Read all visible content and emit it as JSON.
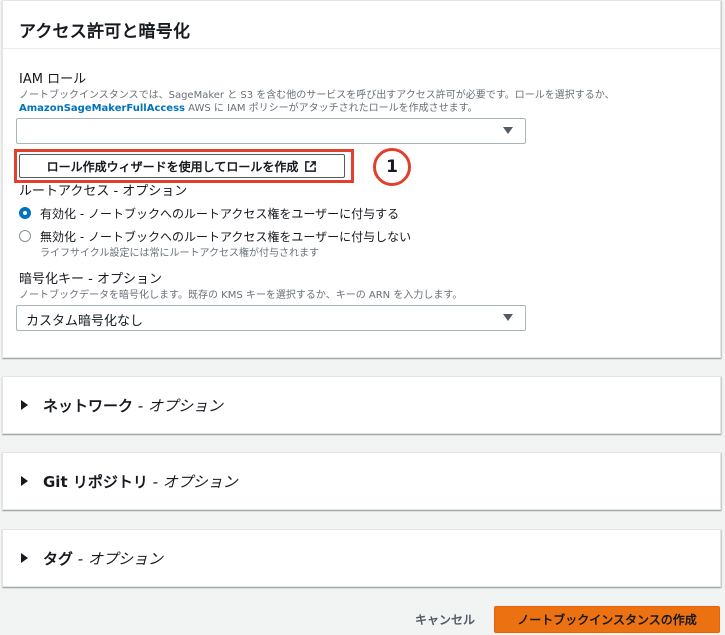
{
  "access_section": {
    "title": "アクセス許可と暗号化",
    "iam_role": {
      "label": "IAM ロール",
      "desc_line1": "ノートブックインスタンスでは、SageMaker と S3 を含む他のサービスを呼び出すアクセス許可が必要です。ロールを選択するか、",
      "desc_link": "AmazonSageMakerFullAccess",
      "desc_line2_rest": " AWS に IAM ポリシーがアタッチされたロールを作成させます。",
      "select_value": ""
    },
    "wizard_button": {
      "label": "ロール作成ウィザードを使用してロールを作成",
      "icon": "external-link-icon"
    },
    "callout_number": "1",
    "root_access": {
      "label": "ルートアクセス - オプション",
      "options": [
        {
          "label": "有効化 - ノートブックへのルートアクセス権をユーザーに付与する",
          "checked": true
        },
        {
          "label": "無効化 - ノートブックへのルートアクセス権をユーザーに付与しない",
          "checked": false,
          "sub": "ライフサイクル設定には常にルートアクセス権が付与されます"
        }
      ]
    },
    "encryption": {
      "label": "暗号化キー - オプション",
      "desc": "ノートブックデータを暗号化します。既存の KMS キーを選択するか、キーの ARN を入力します。",
      "select_value": "カスタム暗号化なし"
    }
  },
  "collapsed_sections": [
    {
      "title": "ネットワーク",
      "suffix": " - オプション"
    },
    {
      "title": "Git リポジトリ",
      "suffix": " - オプション"
    },
    {
      "title": "タグ",
      "suffix": " - オプション"
    }
  ],
  "footer": {
    "cancel_label": "キャンセル",
    "create_label": "ノートブックインスタンスの作成"
  },
  "colors": {
    "primary_button": "#ec7211",
    "link": "#0073bb",
    "callout": "#e0402c"
  }
}
